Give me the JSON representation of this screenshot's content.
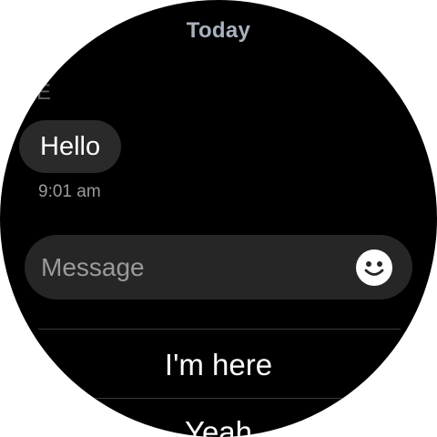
{
  "header": {
    "title": "Today"
  },
  "conversation": {
    "sender_initial": "E",
    "messages": [
      {
        "text": "Hello",
        "time": "9:01 am"
      }
    ]
  },
  "compose": {
    "placeholder": "Message",
    "emoji_icon": "smiley-face-icon"
  },
  "quick_replies": [
    {
      "label": "I'm here"
    },
    {
      "label": "Yeah"
    }
  ],
  "colors": {
    "background": "#000000",
    "bubble": "#2a2a2a",
    "input": "#262626",
    "header_text": "#a9b2be",
    "secondary_text": "#9a9a9a"
  }
}
